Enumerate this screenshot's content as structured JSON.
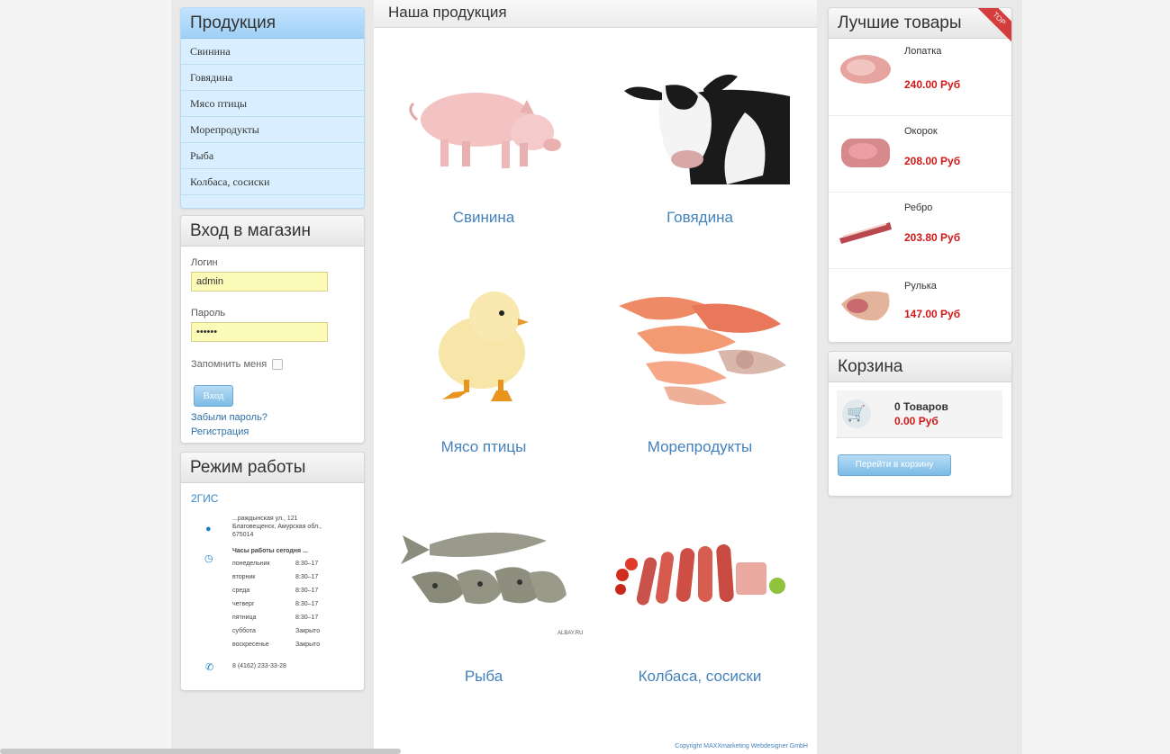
{
  "products_menu": {
    "title": "Продукция",
    "items": [
      "Свинина",
      "Говядина",
      "Мясо птицы",
      "Морепродукты",
      "Рыба",
      "Колбаса, сосиски"
    ]
  },
  "login": {
    "title": "Вход в магазин",
    "login_label": "Логин",
    "login_value": "admin",
    "password_label": "Пароль",
    "password_value": "••••••",
    "remember_label": "Запомнить меня",
    "submit_label": "Вход",
    "forgot_link": "Забыли пароль?",
    "register_link": "Регистрация"
  },
  "hours": {
    "title": "Режим работы",
    "gis_link": "2ГИС",
    "address_lines": [
      "...раждынская ул., 121",
      "Благовещенск, Амурская обл.,",
      "675014"
    ],
    "hours_title": "Часы работы сегодня ...",
    "schedule": [
      {
        "day": "понедельник",
        "time": "8:30–17"
      },
      {
        "day": "вторник",
        "time": "8:30–17"
      },
      {
        "day": "среда",
        "time": "8:30–17"
      },
      {
        "day": "четверг",
        "time": "8:30–17"
      },
      {
        "day": "пятница",
        "time": "8:30–17"
      },
      {
        "day": "суббота",
        "time": "Закрыто"
      },
      {
        "day": "воскресенье",
        "time": "Закрыто"
      }
    ],
    "phone": "8 (4162) 233-33-28"
  },
  "center": {
    "title": "Наша продукция",
    "products": [
      {
        "label": "Свинина"
      },
      {
        "label": "Говядина"
      },
      {
        "label": "Мясо птицы"
      },
      {
        "label": "Морепродукты"
      },
      {
        "label": "Рыба"
      },
      {
        "label": "Колбаса, сосиски"
      }
    ],
    "watermark": "ALBAY.RU",
    "copyright": "Copyright MAXXmarketing Webdesigner GmbH"
  },
  "best": {
    "title": "Лучшие товары",
    "ribbon": "TOP",
    "items": [
      {
        "name": "Лопатка",
        "price": "240.00 Руб"
      },
      {
        "name": "Окорок",
        "price": "208.00 Руб"
      },
      {
        "name": "Ребро",
        "price": "203.80 Руб"
      },
      {
        "name": "Рулька",
        "price": "147.00 Руб"
      }
    ]
  },
  "cart": {
    "title": "Корзина",
    "count": "0 Товаров",
    "sum": "0.00 Руб",
    "button": "Перейти в корзину"
  },
  "colors": {
    "link_blue": "#4382bd",
    "price_red": "#d01818",
    "menu_bg": "#d9efff"
  }
}
